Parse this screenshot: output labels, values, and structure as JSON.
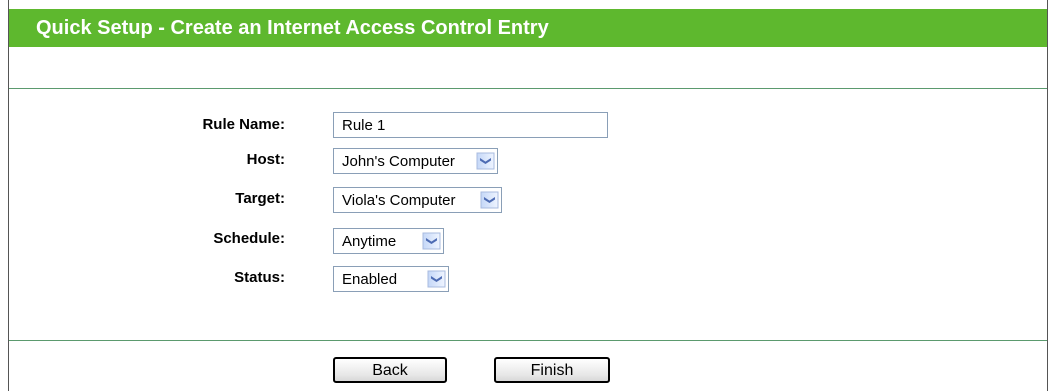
{
  "header": {
    "title": "Quick Setup - Create an Internet Access Control Entry"
  },
  "form": {
    "rule_name": {
      "label": "Rule Name:",
      "value": "Rule 1"
    },
    "host": {
      "label": "Host:",
      "value": "John's Computer"
    },
    "target": {
      "label": "Target:",
      "value": "Viola's Computer"
    },
    "schedule": {
      "label": "Schedule:",
      "value": "Anytime"
    },
    "status": {
      "label": "Status:",
      "value": "Enabled"
    }
  },
  "buttons": {
    "back": "Back",
    "finish": "Finish"
  },
  "icons": {
    "dropdown": "chevron-down-icon"
  },
  "colors": {
    "title_bar": "#5eb82e",
    "divider": "#5b9a6e",
    "select_border": "#8a9fb7"
  }
}
